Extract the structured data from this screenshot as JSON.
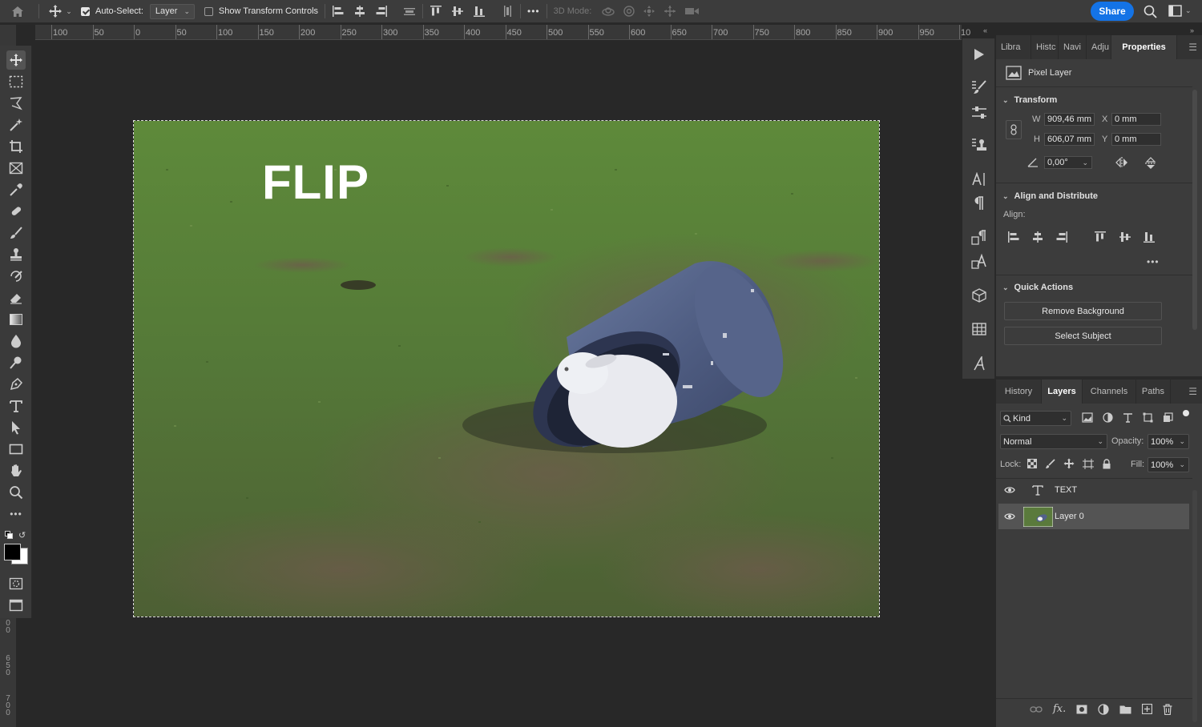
{
  "optionsbar": {
    "auto_select_label": "Auto-Select:",
    "auto_select_value": "Layer",
    "show_transform_label": "Show Transform Controls",
    "mode_3d_label": "3D Mode:",
    "share_label": "Share",
    "more_label": "•••"
  },
  "ruler": {
    "ticks": [
      "100",
      "50",
      "0",
      "50",
      "100",
      "150",
      "200",
      "250",
      "300",
      "350",
      "400",
      "450",
      "500",
      "550",
      "600",
      "650",
      "700",
      "750",
      "800",
      "850",
      "900",
      "950",
      "10"
    ],
    "vticks": [
      "0\n0",
      "6\n5\n0",
      "7\n0\n0"
    ]
  },
  "canvas": {
    "text_layer": "FLIP"
  },
  "properties": {
    "tabs": [
      "Libra",
      "Histc",
      "Navi",
      "Adju",
      "Properties"
    ],
    "active_tab": "Properties",
    "layer_kind": "Pixel Layer",
    "transform_title": "Transform",
    "w_label": "W",
    "w_value": "909,46 mm",
    "h_label": "H",
    "h_value": "606,07 mm",
    "x_label": "X",
    "x_value": "0 mm",
    "y_label": "Y",
    "y_value": "0 mm",
    "angle_value": "0,00°",
    "align_title": "Align and Distribute",
    "align_label": "Align:",
    "more_label": "•••",
    "quick_title": "Quick Actions",
    "remove_bg": "Remove Background",
    "select_subject": "Select Subject"
  },
  "layers": {
    "tabs": [
      "History",
      "Layers",
      "Channels",
      "Paths"
    ],
    "active_tab": "Layers",
    "filter_kind": "Kind",
    "blend_mode": "Normal",
    "opacity_label": "Opacity:",
    "opacity_value": "100%",
    "lock_label": "Lock:",
    "fill_label": "Fill:",
    "fill_value": "100%",
    "items": [
      {
        "name": "TEXT",
        "type": "text"
      },
      {
        "name": "Layer 0",
        "type": "pixel"
      }
    ]
  },
  "colors": {
    "accent": "#1473e6",
    "panel": "#3c3c3c",
    "canvas_bg": "#282828"
  }
}
